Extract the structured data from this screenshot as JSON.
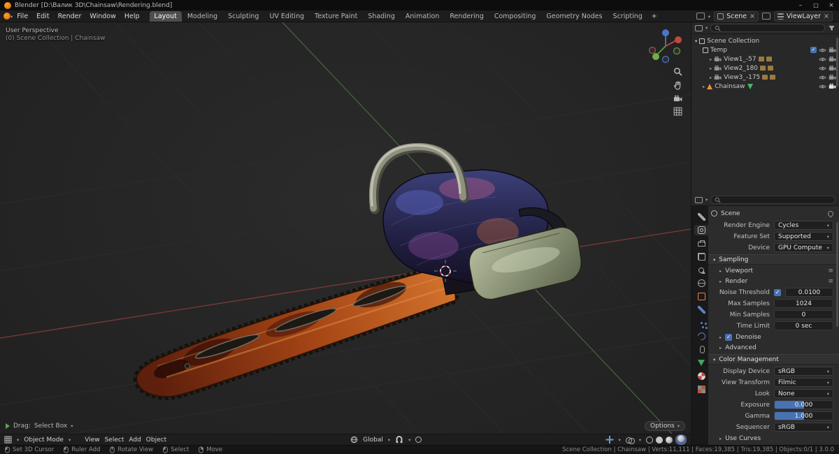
{
  "colors": {
    "accent": "#4772b3",
    "object_orange": "#e8843c"
  },
  "titlebar": {
    "app_title": "Blender [D:\\Валик 3D\\Chainsaw\\Rendering.blend]"
  },
  "menubar": {
    "menus": [
      "File",
      "Edit",
      "Render",
      "Window",
      "Help"
    ],
    "workspaces": [
      "Layout",
      "Modeling",
      "Sculpting",
      "UV Editing",
      "Texture Paint",
      "Shading",
      "Animation",
      "Rendering",
      "Compositing",
      "Geometry Nodes",
      "Scripting"
    ],
    "add_workspace": "+",
    "scene": {
      "label": "Scene"
    },
    "viewlayer": {
      "label": "ViewLayer"
    }
  },
  "viewport": {
    "overlay": {
      "line1": "User Perspective",
      "line2": "(0) Scene Collection | Chainsaw"
    },
    "tool_hint": {
      "drag": "Drag:",
      "tool": "Select Box"
    },
    "options": "Options",
    "header": {
      "mode": "Object Mode",
      "menu_view": "View",
      "menu_select": "Select",
      "menu_add": "Add",
      "menu_object": "Object",
      "orientation": "Global"
    }
  },
  "outliner": {
    "scene_collection": "Scene Collection",
    "items": [
      {
        "label": "Temp"
      },
      {
        "label": "View1_-57"
      },
      {
        "label": "View2_180"
      },
      {
        "label": "View3_-175"
      },
      {
        "label": "Chainsaw"
      }
    ]
  },
  "properties": {
    "breadcrumb": "Scene",
    "render_engine": {
      "label": "Render Engine",
      "value": "Cycles"
    },
    "feature_set": {
      "label": "Feature Set",
      "value": "Supported"
    },
    "device": {
      "label": "Device",
      "value": "GPU Compute"
    },
    "sampling": {
      "title": "Sampling",
      "viewport": "Viewport",
      "render": "Render",
      "noise_threshold": {
        "label": "Noise Threshold",
        "value": "0.0100"
      },
      "max_samples": {
        "label": "Max Samples",
        "value": "1024"
      },
      "min_samples": {
        "label": "Min Samples",
        "value": "0"
      },
      "time_limit": {
        "label": "Time Limit",
        "value": "0 sec"
      },
      "denoise": "Denoise",
      "advanced": "Advanced"
    },
    "color_management": {
      "title": "Color Management",
      "display_device": {
        "label": "Display Device",
        "value": "sRGB"
      },
      "view_transform": {
        "label": "View Transform",
        "value": "Filmic"
      },
      "look": {
        "label": "Look",
        "value": "None"
      },
      "exposure": {
        "label": "Exposure",
        "value": "0.000"
      },
      "gamma": {
        "label": "Gamma",
        "value": "1.000"
      },
      "sequencer": {
        "label": "Sequencer",
        "value": "sRGB"
      },
      "use_curves": "Use Curves"
    }
  },
  "statusbar": {
    "hints": [
      {
        "label": "Set 3D Cursor"
      },
      {
        "label": "Ruler Add"
      },
      {
        "label": "Rotate View"
      },
      {
        "label": "Select"
      },
      {
        "label": "Move"
      }
    ],
    "stats": "Scene Collection | Chainsaw | Verts:11,111 | Faces:19,385 | Tris:19,385 | Objects:0/1 | 3.0.0"
  }
}
